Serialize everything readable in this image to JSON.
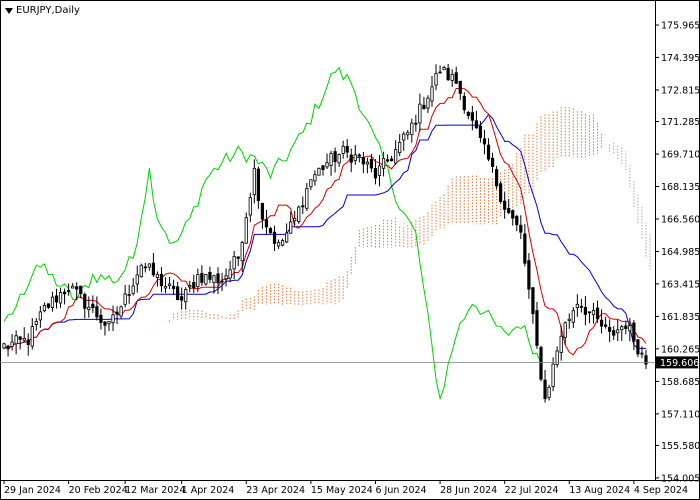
{
  "header": {
    "symbol_label": "EURJPY,Daily"
  },
  "chart_data": {
    "type": "candlestick",
    "title": "EURJPY,Daily",
    "ylim": [
      154.0,
      176.5
    ],
    "y_ticks": [
      175.965,
      174.395,
      172.815,
      171.285,
      169.71,
      168.135,
      166.56,
      164.985,
      163.415,
      161.835,
      160.265,
      158.685,
      157.11,
      155.58,
      154.005
    ],
    "x_ticks": [
      "29 Jan 2024",
      "20 Feb 2024",
      "12 Mar 2024",
      "1 Apr 2024",
      "23 Apr 2024",
      "15 May 2024",
      "6 Jun 2024",
      "28 Jun 2024",
      "22 Jul 2024",
      "13 Aug 2024",
      "4 Sep 2024"
    ],
    "x_tick_index": [
      0,
      16,
      30,
      44,
      60,
      76,
      92,
      108,
      124,
      140,
      156
    ],
    "n_bars": 160,
    "current_price": 159.606,
    "ohlc_anchors": [
      [
        0,
        160.4
      ],
      [
        6,
        160.7
      ],
      [
        10,
        162.2
      ],
      [
        16,
        163.3
      ],
      [
        20,
        162.5
      ],
      [
        26,
        161.3
      ],
      [
        30,
        162.7
      ],
      [
        34,
        164.4
      ],
      [
        38,
        163.7
      ],
      [
        44,
        162.6
      ],
      [
        48,
        163.8
      ],
      [
        54,
        163.6
      ],
      [
        58,
        164.7
      ],
      [
        62,
        168.9
      ],
      [
        64,
        166.7
      ],
      [
        68,
        165.2
      ],
      [
        72,
        166.5
      ],
      [
        76,
        168.5
      ],
      [
        80,
        169.3
      ],
      [
        84,
        169.8
      ],
      [
        88,
        169.5
      ],
      [
        92,
        168.7
      ],
      [
        96,
        169.6
      ],
      [
        100,
        170.7
      ],
      [
        104,
        172.2
      ],
      [
        108,
        173.8
      ],
      [
        112,
        173.2
      ],
      [
        116,
        171.2
      ],
      [
        120,
        169.4
      ],
      [
        124,
        167.2
      ],
      [
        128,
        165.8
      ],
      [
        132,
        160.3
      ],
      [
        134,
        157.8
      ],
      [
        138,
        161.0
      ],
      [
        142,
        162.6
      ],
      [
        146,
        161.8
      ],
      [
        150,
        160.9
      ],
      [
        154,
        161.5
      ],
      [
        159,
        159.6
      ]
    ],
    "series": [
      {
        "name": "tenkan",
        "color": "#d40000"
      },
      {
        "name": "kijun",
        "color": "#0000c8"
      },
      {
        "name": "chikou",
        "color": "#00d200"
      },
      {
        "name": "senkou_a",
        "color": "#e07a3c"
      },
      {
        "name": "senkou_b",
        "color": "#b79ad0"
      }
    ]
  }
}
